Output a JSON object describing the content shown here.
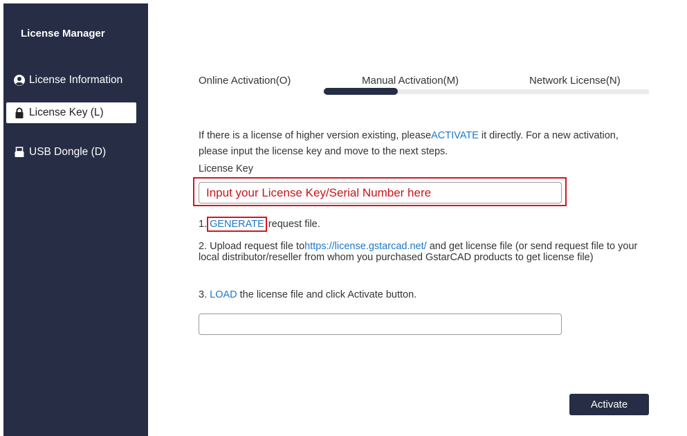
{
  "sidebar": {
    "title": "License Manager",
    "items": [
      {
        "label": "License Information",
        "icon": "user-circle-icon",
        "active": false
      },
      {
        "label": "License Key (L)",
        "icon": "lock-icon",
        "active": true
      },
      {
        "label": "USB Dongle (D)",
        "icon": "usb-dongle-icon",
        "active": false
      }
    ]
  },
  "tabs": [
    {
      "label": "Online Activation(O)",
      "active": false
    },
    {
      "label": "Manual Activation(M)",
      "active": true
    },
    {
      "label": "Network License(N)",
      "active": false
    }
  ],
  "main": {
    "intro_before": "If there is a license of higher version existing, please",
    "intro_link": "ACTIVATE",
    "intro_after": " it directly. For a new activation, please input the license key and move to the next steps.",
    "license_key_label": "License Key",
    "license_key_value": "Input your License Key/Serial Number here",
    "step1_prefix": "1.",
    "step1_link": "GENERATE",
    "step1_suffix": " request file.",
    "step2_prefix": "2. Upload request file to",
    "step2_link": "https://license.gstarcad.net/",
    "step2_suffix": " and get license file (or send request file to your local distributor/reseller from whom you purchased GstarCAD products to get license file)",
    "step3_prefix": "3. ",
    "step3_link": "LOAD",
    "step3_suffix": " the license file and click Activate button.",
    "file_path_value": "",
    "activate_label": "Activate"
  },
  "colors": {
    "sidebar_bg": "#262d45",
    "link": "#1e78c8",
    "highlight": "#d8141c"
  }
}
